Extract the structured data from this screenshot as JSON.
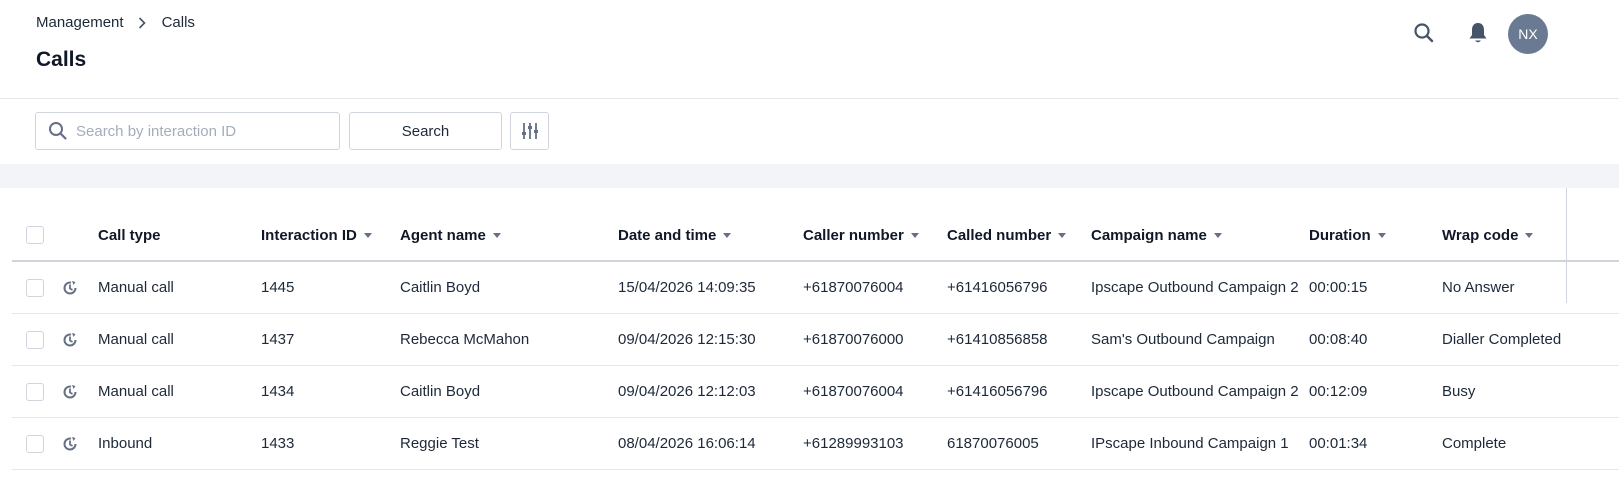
{
  "breadcrumb": {
    "parent": "Management",
    "current": "Calls"
  },
  "page_title": "Calls",
  "header_icons": {
    "search": "search-icon",
    "notifications": "bell-icon"
  },
  "avatar": {
    "initials": "NX",
    "color": "#6b7a93"
  },
  "search": {
    "placeholder": "Search by interaction ID",
    "value": "",
    "button_label": "Search"
  },
  "filter": {
    "icon": "sliders-icon"
  },
  "table": {
    "columns": [
      "Call type",
      "Interaction ID",
      "Agent name",
      "Date and time",
      "Caller number",
      "Called number",
      "Campaign name",
      "Duration",
      "Wrap code"
    ],
    "rows": [
      {
        "call_type": "Manual call",
        "interaction_id": "1445",
        "agent_name": "Caitlin Boyd",
        "date_time": "15/04/2026 14:09:35",
        "caller_number": "+61870076004",
        "called_number": "+61416056796",
        "campaign_name": "Ipscape Outbound Campaign 2",
        "duration": "00:00:15",
        "wrap_code": "No Answer"
      },
      {
        "call_type": "Manual call",
        "interaction_id": "1437",
        "agent_name": "Rebecca McMahon",
        "date_time": "09/04/2026 12:15:30",
        "caller_number": "+61870076000",
        "called_number": "+61410856858",
        "campaign_name": "Sam's Outbound Campaign",
        "duration": "00:08:40",
        "wrap_code": "Dialler Completed"
      },
      {
        "call_type": "Manual call",
        "interaction_id": "1434",
        "agent_name": "Caitlin Boyd",
        "date_time": "09/04/2026 12:12:03",
        "caller_number": "+61870076004",
        "called_number": "+61416056796",
        "campaign_name": "Ipscape Outbound Campaign 2",
        "duration": "00:12:09",
        "wrap_code": "Busy"
      },
      {
        "call_type": "Inbound",
        "interaction_id": "1433",
        "agent_name": "Reggie Test",
        "date_time": "08/04/2026 16:06:14",
        "caller_number": "+61289993103",
        "called_number": "61870076005",
        "campaign_name": "IPscape Inbound Campaign 1",
        "duration": "00:01:34",
        "wrap_code": "Complete"
      }
    ]
  }
}
